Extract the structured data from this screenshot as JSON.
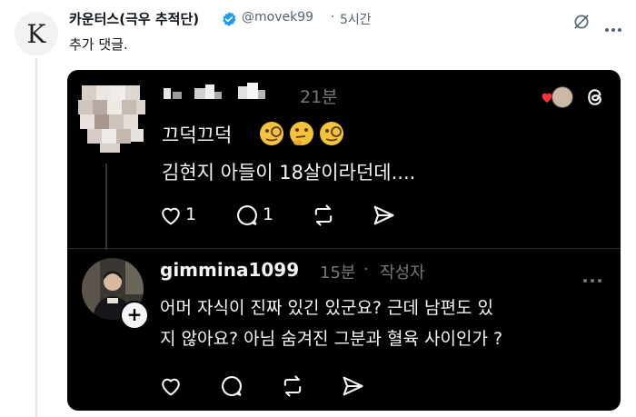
{
  "tweet": {
    "author_avatar_letter": "K",
    "display_name": "카운터스(극우 추적단)",
    "handle": "@movek99",
    "separator": "·",
    "time": "5시간",
    "text": "추가 댓글.",
    "verified_color": "#1d9bf0"
  },
  "embedded": {
    "reply1": {
      "username": "(pixelated)",
      "time": "21분",
      "line1": "끄덕끄덕",
      "emojis": "🧐🤔🧐",
      "line2": "김현지 아들이 18살이라던데....",
      "likes": "1",
      "comments": "1"
    },
    "reply2": {
      "username": "gimmina1099",
      "time": "15분",
      "separator": "·",
      "badge": "작성자",
      "line1": "어머 자식이 진짜 있긴 있군요?  근데 남편도 있",
      "line2": "지 않아요? 아님 숨겨진 그분과  혈육 사이인가 ?"
    },
    "colors": {
      "background": "#000000",
      "text": "#f3f5f7",
      "secondary": "#777777",
      "heart": "#ff3040"
    }
  }
}
